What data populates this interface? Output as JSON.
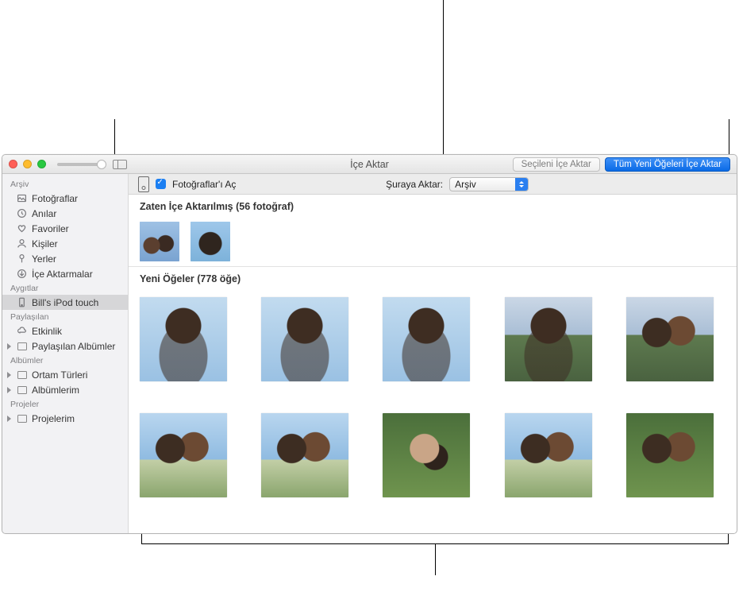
{
  "titlebar": {
    "title": "İçe Aktar",
    "import_selected_label": "Seçileni İçe Aktar",
    "import_all_new_label": "Tüm Yeni Öğeleri İçe Aktar"
  },
  "import_bar": {
    "open_photos_label": "Fotoğraflar'ı Aç",
    "open_photos_checked": true,
    "import_to_label": "Şuraya Aktar:",
    "destination_value": "Arşiv"
  },
  "sections": {
    "already_imported_label": "Zaten İçe Aktarılmış (56 fotoğraf)",
    "already_imported_count": 56,
    "new_items_label": "Yeni Öğeler (778 öğe)",
    "new_items_count": 778
  },
  "sidebar": {
    "groups": [
      {
        "label": "Arşiv",
        "items": [
          {
            "icon": "photos",
            "label": "Fotoğraflar"
          },
          {
            "icon": "clock",
            "label": "Anılar"
          },
          {
            "icon": "heart",
            "label": "Favoriler"
          },
          {
            "icon": "person",
            "label": "Kişiler"
          },
          {
            "icon": "pin",
            "label": "Yerler"
          },
          {
            "icon": "download",
            "label": "İçe Aktarmalar"
          }
        ]
      },
      {
        "label": "Aygıtlar",
        "items": [
          {
            "icon": "device",
            "label": "Bill's iPod touch",
            "selected": true
          }
        ]
      },
      {
        "label": "Paylaşılan",
        "items": [
          {
            "icon": "cloud",
            "label": "Etkinlik"
          },
          {
            "icon": "rect",
            "label": "Paylaşılan Albümler",
            "expandable": true
          }
        ]
      },
      {
        "label": "Albümler",
        "items": [
          {
            "icon": "rect",
            "label": "Ortam Türleri",
            "expandable": true
          },
          {
            "icon": "rect",
            "label": "Albümlerim",
            "expandable": true
          }
        ]
      },
      {
        "label": "Projeler",
        "items": [
          {
            "icon": "rect",
            "label": "Projelerim",
            "expandable": true
          }
        ]
      }
    ]
  },
  "already_imported_thumbs": [
    {
      "is_video": true
    },
    {
      "is_video": false
    }
  ],
  "new_item_thumbs_visible": 10
}
